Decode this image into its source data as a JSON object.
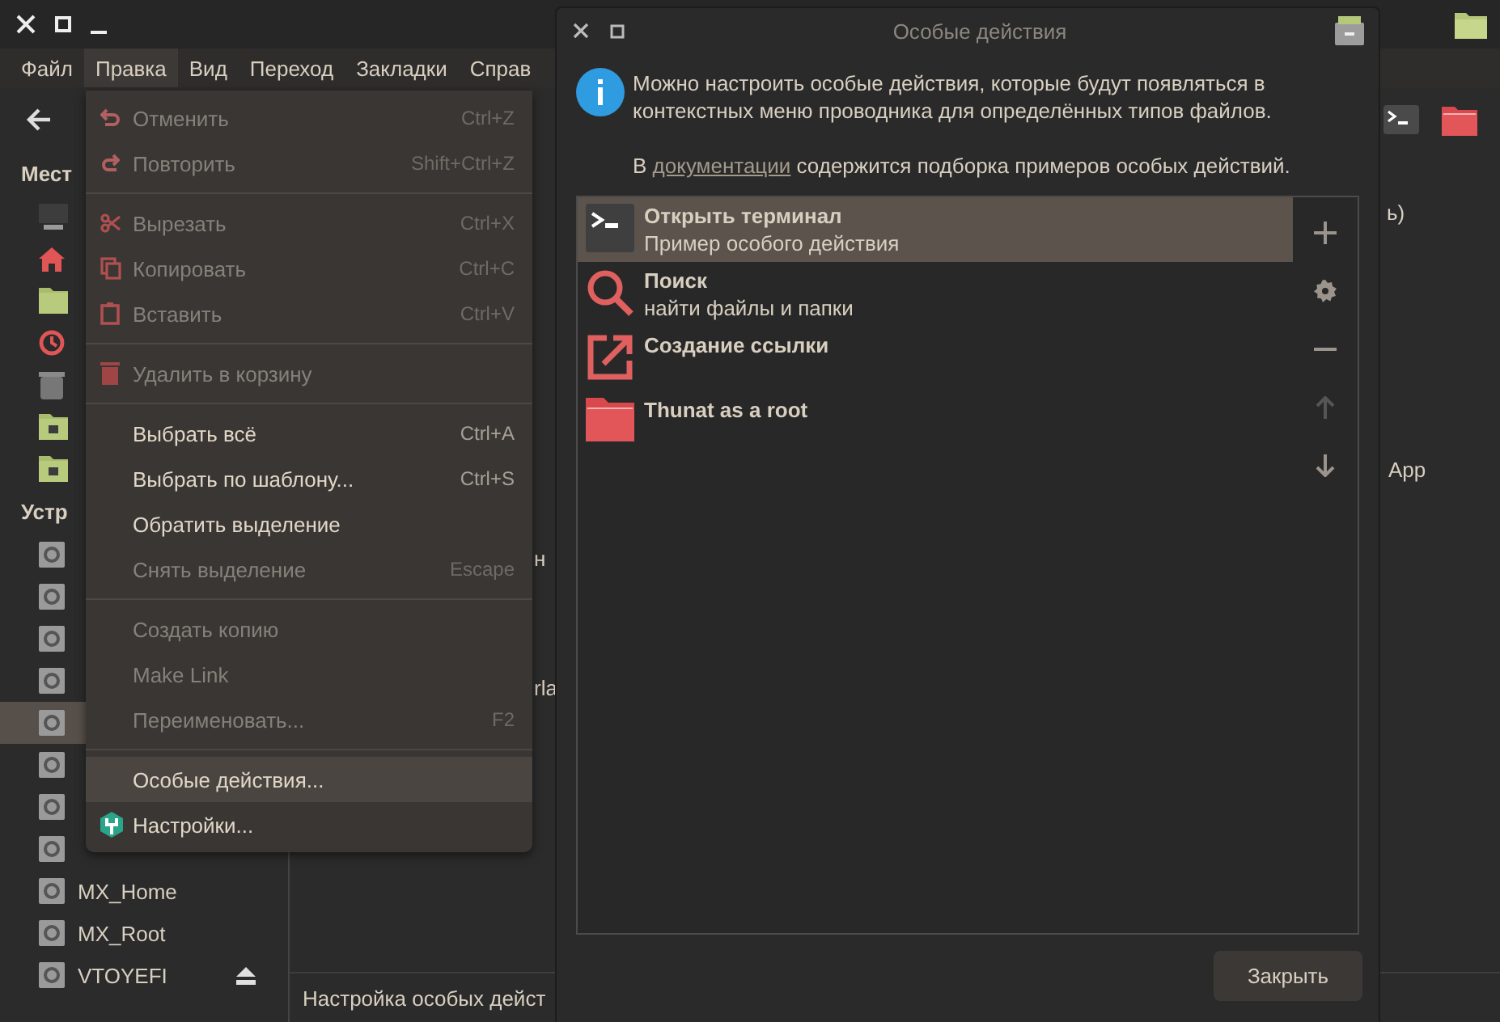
{
  "main_window": {
    "menubar": [
      {
        "label": "Файл",
        "selected": false
      },
      {
        "label": "Правка",
        "selected": true
      },
      {
        "label": "Вид",
        "selected": false
      },
      {
        "label": "Переход",
        "selected": false
      },
      {
        "label": "Закладки",
        "selected": false
      },
      {
        "label": "Справ",
        "selected": false
      }
    ],
    "sidebar": {
      "places_title": "Мест",
      "places": [
        {
          "selected": false
        },
        {
          "selected": false
        },
        {
          "selected": false
        },
        {
          "selected": false
        },
        {
          "selected": false
        },
        {
          "selected": false
        },
        {
          "selected": false
        }
      ],
      "devices_title": "Устр",
      "devices": [
        {
          "selected": false,
          "ejectable": false
        },
        {
          "selected": false,
          "ejectable": false
        },
        {
          "selected": false,
          "ejectable": false
        },
        {
          "selected": false,
          "ejectable": false
        },
        {
          "selected": true,
          "ejectable": false
        },
        {
          "selected": false,
          "ejectable": false
        },
        {
          "selected": false,
          "ejectable": false
        },
        {
          "selected": false,
          "ejectable": false
        },
        {
          "label": "MX_Home",
          "selected": false,
          "ejectable": false
        },
        {
          "label": "MX_Root",
          "selected": false,
          "ejectable": false
        },
        {
          "label": "VTOYEFI",
          "selected": false,
          "ejectable": true
        }
      ]
    },
    "content_fragments": [
      "н",
      "rla",
      "ь)",
      "App"
    ],
    "status_bar": "Настройка особых дейст"
  },
  "edit_menu": [
    {
      "kind": "item",
      "label": "Отменить",
      "shortcut": "Ctrl+Z",
      "disabled": true,
      "selected": false
    },
    {
      "kind": "item",
      "label": "Повторить",
      "shortcut": "Shift+Ctrl+Z",
      "disabled": true,
      "selected": false
    },
    {
      "kind": "separator"
    },
    {
      "kind": "item",
      "label": "Вырезать",
      "shortcut": "Ctrl+X",
      "disabled": true,
      "selected": false
    },
    {
      "kind": "item",
      "label": "Копировать",
      "shortcut": "Ctrl+C",
      "disabled": true,
      "selected": false
    },
    {
      "kind": "item",
      "label": "Вставить",
      "shortcut": "Ctrl+V",
      "disabled": true,
      "selected": false
    },
    {
      "kind": "separator"
    },
    {
      "kind": "item",
      "label": "Удалить в корзину",
      "disabled": true,
      "selected": false
    },
    {
      "kind": "separator"
    },
    {
      "kind": "item",
      "label": "Выбрать всё",
      "shortcut": "Ctrl+A",
      "disabled": false,
      "selected": false
    },
    {
      "kind": "item",
      "label": "Выбрать по шаблону...",
      "shortcut": "Ctrl+S",
      "disabled": false,
      "selected": false
    },
    {
      "kind": "item",
      "label": "Обратить выделение",
      "disabled": false,
      "selected": false
    },
    {
      "kind": "item",
      "label": "Снять выделение",
      "shortcut": "Escape",
      "disabled": true,
      "selected": false
    },
    {
      "kind": "separator"
    },
    {
      "kind": "item",
      "label": "Создать копию",
      "disabled": true,
      "selected": false
    },
    {
      "kind": "item",
      "label": "Make Link",
      "disabled": true,
      "selected": false
    },
    {
      "kind": "item",
      "label": "Переименовать...",
      "shortcut": "F2",
      "disabled": true,
      "selected": false
    },
    {
      "kind": "separator"
    },
    {
      "kind": "item",
      "label": "Особые действия...",
      "disabled": false,
      "selected": true
    },
    {
      "kind": "item",
      "label": "Настройки...",
      "disabled": false,
      "selected": false
    }
  ],
  "dialog": {
    "title": "Особые действия",
    "info": "Можно настроить особые действия, которые будут появляться в контекстных меню проводника для определённых типов файлов.",
    "doc_before": "В",
    "doc_link": "документации",
    "doc_after": "содержится подборка примеров особых действий.",
    "actions": [
      {
        "name": "Открыть терминал",
        "description": "Пример особого действия",
        "selected": true
      },
      {
        "name": "Поиск",
        "description": "найти файлы и папки",
        "selected": false
      },
      {
        "name": "Создание ссылки",
        "selected": false
      },
      {
        "name": "Thunat as a root",
        "selected": false
      }
    ],
    "tools": [
      {
        "disabled": false
      },
      {
        "disabled": false
      },
      {
        "disabled": false
      },
      {
        "disabled": true
      },
      {
        "disabled": false
      }
    ],
    "close_button": "Закрыть"
  }
}
